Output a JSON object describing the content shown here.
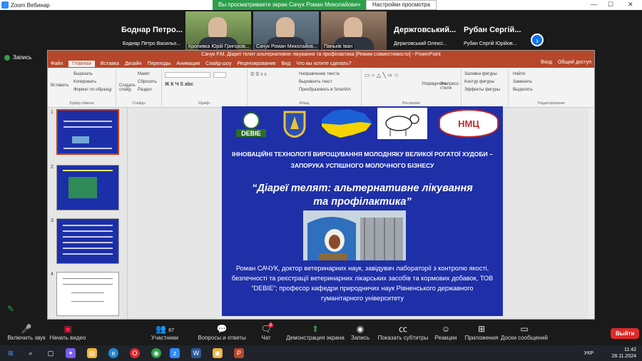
{
  "zoom": {
    "title": "Zoom Вебинар",
    "share_banner": "Вы просматриваете экран Сачук Роман Миколайович",
    "view_options": "Настройки просмотра",
    "record_label": "Запись"
  },
  "gallery": {
    "named": [
      "Боднар Петро...",
      "Держговський...",
      "Рубан Сергій..."
    ],
    "tiles": [
      "Боднар Петро Васильо...",
      "Кропивка Юрій Григоров...",
      "Сачук Роман Миколайов...",
      "Паньків Іван",
      "Держговський Олексі...",
      "Рубан Сергій Юрійов..."
    ]
  },
  "ppt": {
    "window_title": "Сачук Р.М. Діареї телят альтернативне лікування та профілактика [Режим совместимости] - PowerPoint",
    "tabs": [
      "Файл",
      "Главная",
      "Вставка",
      "Дизайн",
      "Переходы",
      "Анимация",
      "Слайд-шоу",
      "Рецензирование",
      "Вид",
      "Что вы хотите сделать?"
    ],
    "tabs_right": [
      "Вход",
      "Общий доступ"
    ],
    "ribbon": {
      "paste": "Вставить",
      "cut": "Вырезать",
      "copy": "Копировать",
      "format_painter": "Формат по образцу",
      "clipboard": "Буфер обмена",
      "new_slide": "Создать слайд",
      "layout": "Макет",
      "reset": "Сбросить",
      "section": "Раздел",
      "slides": "Слайды",
      "font": "Шрифт",
      "paragraph": "Абзац",
      "text_dir": "Направление текста",
      "align_text": "Выровнять текст",
      "smartart": "Преобразовать в SmartArt",
      "arrange": "Упорядочить",
      "quick_styles": "Экспресс-стили",
      "drawing": "Рисование",
      "fill": "Заливка фигуры",
      "outline": "Контур фигуры",
      "effects": "Эффекты фигуры",
      "find": "Найти",
      "replace": "Заменить",
      "select": "Выделить",
      "editing": "Редактирование"
    },
    "slide_numbers": [
      "1",
      "2",
      "3",
      "4"
    ]
  },
  "slide": {
    "logo_debie": "DEBIE",
    "logo_nmc": "НМЦ",
    "heading_line1": "ІННОВАЦІЙНІ ТЕХНОЛОГІЇ ВИРОЩУВАННЯ МОЛОДНЯКУ ВЕЛИКОЇ РОГАТОЇ ХУДОБИ –",
    "heading_line2": "ЗАПОРУКА УСПІШНОГО МОЛОЧНОГО БІЗНЕСУ",
    "title_line1": "“Діареї телят: альтернативне лікування",
    "title_line2": "та профілактика”",
    "author": "Роман САЧУК, доктор ветеринарних наук, завідувач лабораторії з контролю якості, безпечності та реєстрації ветеринарних лікарських засобів та кормових добавок, ТОВ “DEBIE”; професор кафедри природничих наук Рівненського державного гуманітарного університету"
  },
  "toolbar": {
    "unmute": "Включить звук",
    "video": "Начать видео",
    "participants": "Участники",
    "participants_count": "67",
    "qa": "Вопросы и ответы",
    "chat": "Чат",
    "chat_badge": "5",
    "share": "Демонстрация экрана",
    "record": "Запись",
    "captions": "Показать субтитры",
    "reactions": "Реакции",
    "apps": "Приложения",
    "boards": "Доски сообщений",
    "leave": "Выйти"
  },
  "taskbar": {
    "lang": "УКР",
    "time": "11:42",
    "date": "28.11.2024"
  }
}
